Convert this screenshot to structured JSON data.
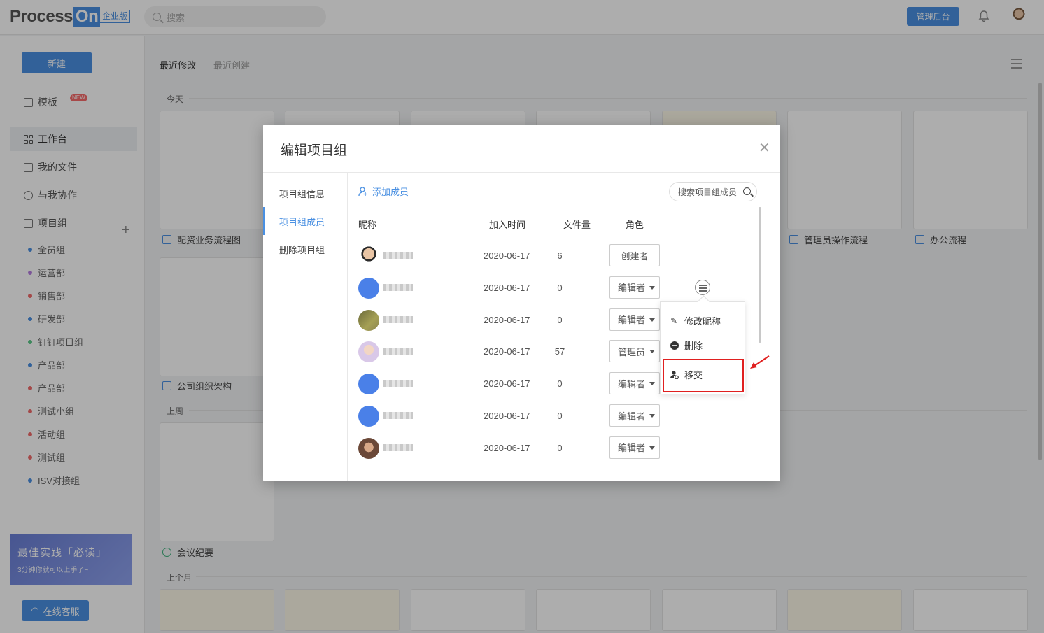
{
  "header": {
    "logo_text": "Process",
    "logo_on": "On",
    "edition_badge": "企业版",
    "search_placeholder": "搜索",
    "admin_button": "管理后台",
    "bell_icon": "bell-icon",
    "accent_color": "#4a90e2"
  },
  "sidebar": {
    "new_button": "新建",
    "templates": "模板",
    "templates_badge": "NEW",
    "workspace": "工作台",
    "my_files": "我的文件",
    "shared_with_me": "与我协作",
    "project_groups": "项目组",
    "groups": [
      {
        "name": "全员组",
        "color": "#4a90e2"
      },
      {
        "name": "运营部",
        "color": "#b67ee0"
      },
      {
        "name": "销售部",
        "color": "#f06a6a"
      },
      {
        "name": "研发部",
        "color": "#4a90e2"
      },
      {
        "name": "钉钉项目组",
        "color": "#5cc98a"
      },
      {
        "name": "产品部",
        "color": "#4a90e2"
      },
      {
        "name": "产品部",
        "color": "#f06a6a"
      },
      {
        "name": "测试小组",
        "color": "#f06a6a"
      },
      {
        "name": "活动组",
        "color": "#f06a6a"
      },
      {
        "name": "测试组",
        "color": "#f06a6a"
      },
      {
        "name": "ISV对接组",
        "color": "#4a90e2"
      }
    ],
    "promo_title": "最佳实践「必读」",
    "promo_sub": "3分钟你就可以上手了~",
    "service_button": "在线客服"
  },
  "main": {
    "tabs": [
      "最近修改",
      "最近创建"
    ],
    "sections": [
      "今天",
      "上周",
      "上个月"
    ],
    "cards": [
      {
        "label": "配资业务流程图"
      },
      {
        "label": "管理员操作流程"
      },
      {
        "label": "办公流程"
      },
      {
        "label": "公司组织架构"
      },
      {
        "label": "会议纪要"
      }
    ]
  },
  "modal": {
    "title": "编辑项目组",
    "nav": [
      "项目组信息",
      "项目组成员",
      "删除项目组"
    ],
    "active_nav": "项目组成员",
    "add_member": "添加成员",
    "search_placeholder": "搜索项目组成员",
    "columns": [
      "昵称",
      "加入时间",
      "文件量",
      "角色"
    ],
    "members": [
      {
        "date": "2020-06-17",
        "files": "6",
        "role": "创建者"
      },
      {
        "date": "2020-06-17",
        "files": "0",
        "role": "编辑者"
      },
      {
        "date": "2020-06-17",
        "files": "0",
        "role": "编辑者"
      },
      {
        "date": "2020-06-17",
        "files": "57",
        "role": "管理员"
      },
      {
        "date": "2020-06-17",
        "files": "0",
        "role": "编辑者"
      },
      {
        "date": "2020-06-17",
        "files": "0",
        "role": "编辑者"
      },
      {
        "date": "2020-06-17",
        "files": "0",
        "role": "编辑者"
      }
    ],
    "context_menu": [
      "修改昵称",
      "删除",
      "移交"
    ],
    "highlight_color": "#e02020"
  }
}
